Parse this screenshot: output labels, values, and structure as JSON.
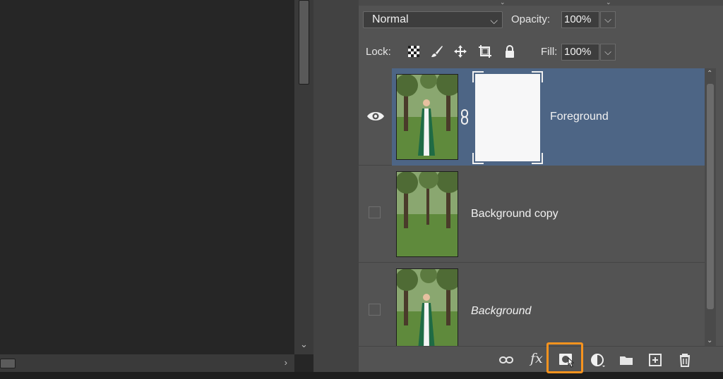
{
  "blend_mode": {
    "selected": "Normal"
  },
  "opacity": {
    "label": "Opacity:",
    "value": "100%"
  },
  "lock": {
    "label": "Lock:"
  },
  "fill": {
    "label": "Fill:",
    "value": "100%"
  },
  "layers": [
    {
      "name": "Foreground",
      "visible": true,
      "selected": true,
      "has_mask": true,
      "italic": false
    },
    {
      "name": "Background copy",
      "visible": false,
      "selected": false,
      "has_mask": false,
      "italic": false
    },
    {
      "name": "Background",
      "visible": false,
      "selected": false,
      "has_mask": false,
      "italic": true,
      "locked": true
    }
  ],
  "footer": {
    "fx_label": "fx",
    "highlighted_tool": "add-layer-mask-button"
  },
  "colors": {
    "panel_bg": "#535353",
    "selected_layer": "#4d6585",
    "highlight": "#f7931e"
  }
}
